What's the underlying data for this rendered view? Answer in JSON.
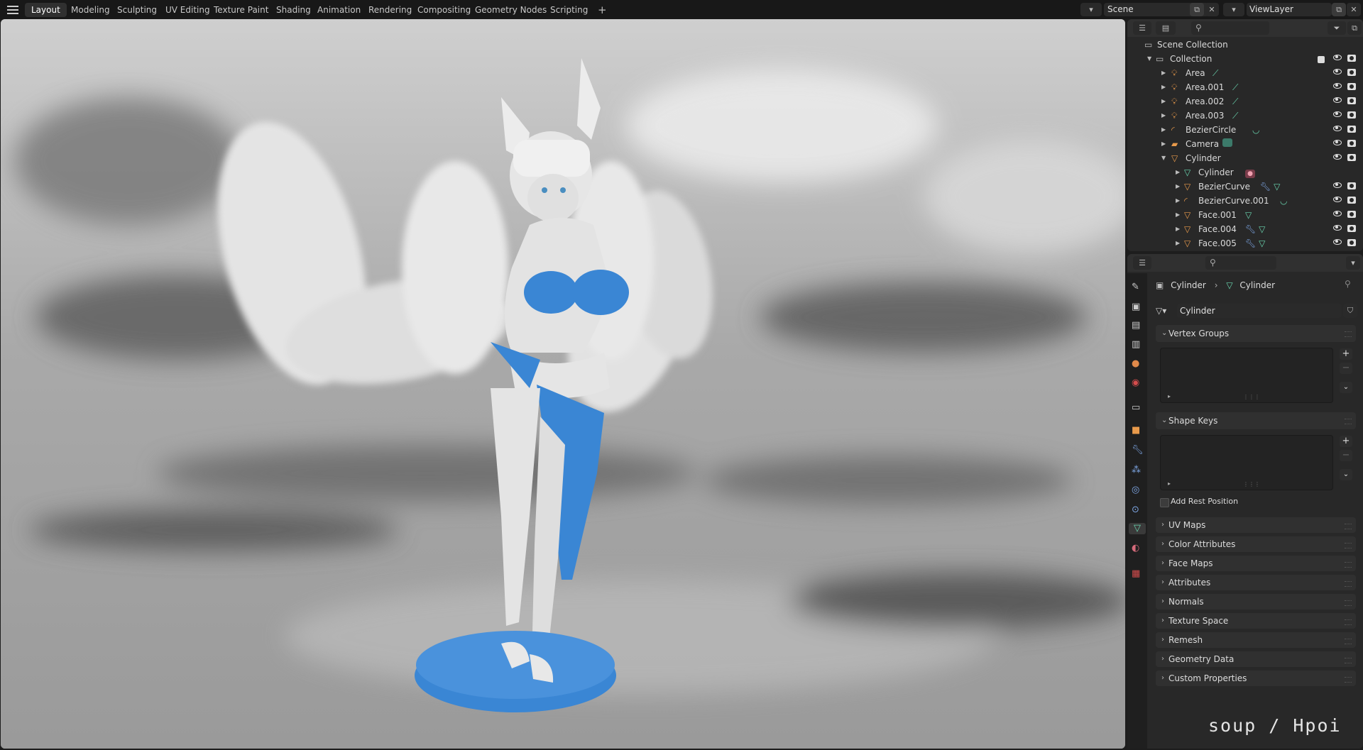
{
  "workspace_tabs": [
    "Layout",
    "Modeling",
    "Sculpting",
    "UV Editing",
    "Texture Paint",
    "Shading",
    "Animation",
    "Rendering",
    "Compositing",
    "Geometry Nodes",
    "Scripting"
  ],
  "active_tab": "Layout",
  "add_tab_label": "+",
  "scene": {
    "name": "Scene"
  },
  "view_layer": {
    "name": "ViewLayer"
  },
  "outliner": {
    "scene_collection": "Scene Collection",
    "collection": "Collection",
    "items": [
      {
        "label": "Area",
        "icon": "light-icon",
        "extra": "light-data-icon"
      },
      {
        "label": "Area.001",
        "icon": "light-icon",
        "extra": "light-data-icon"
      },
      {
        "label": "Area.002",
        "icon": "light-icon",
        "extra": "light-data-icon"
      },
      {
        "label": "Area.003",
        "icon": "light-icon",
        "extra": "light-data-icon"
      },
      {
        "label": "BezierCircle",
        "icon": "curve-icon",
        "extra": "curve-data-icon"
      },
      {
        "label": "Camera",
        "icon": "camera-icon",
        "extra": "camera-data-icon"
      },
      {
        "label": "Cylinder",
        "icon": "mesh-icon",
        "extra": ""
      }
    ],
    "children": [
      {
        "label": "Cylinder",
        "icon": "mesh-data-icon",
        "extra": "material-icon"
      },
      {
        "label": "BezierCurve",
        "icon": "mesh-icon",
        "extra": "modifier-mesh-icons"
      },
      {
        "label": "BezierCurve.001",
        "icon": "curve-icon",
        "extra": "curve-data-icon"
      },
      {
        "label": "Face.001",
        "icon": "mesh-icon",
        "extra": "mesh-data-icon"
      },
      {
        "label": "Face.004",
        "icon": "mesh-icon",
        "extra": "modifier-mesh-icons"
      },
      {
        "label": "Face.005",
        "icon": "mesh-icon",
        "extra": "modifier-mesh-icons"
      }
    ]
  },
  "properties": {
    "breadcrumb_object": "Cylinder",
    "breadcrumb_data": "Cylinder",
    "data_name": "Cylinder",
    "panels_open": [
      "Vertex Groups",
      "Shape Keys"
    ],
    "add_rest_position": "Add Rest Position",
    "panels_closed": [
      "UV Maps",
      "Color Attributes",
      "Face Maps",
      "Attributes",
      "Normals",
      "Texture Space",
      "Remesh",
      "Geometry Data",
      "Custom Properties"
    ]
  },
  "watermark": "soup / Hpoi",
  "colors": {
    "accent_blue": "#3a86d4",
    "outliner_green": "#6ad6b0",
    "mesh_orange": "#e89a4b"
  }
}
